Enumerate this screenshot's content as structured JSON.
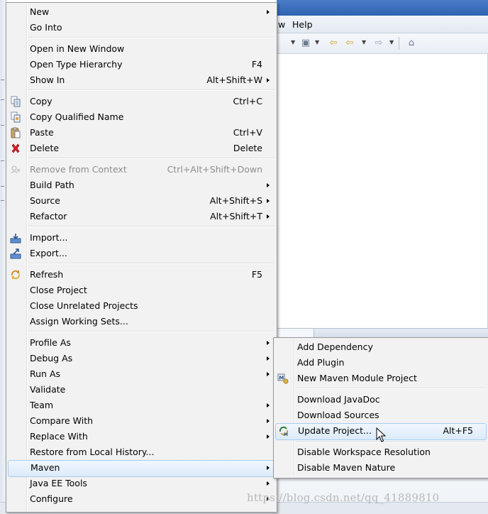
{
  "background": {
    "menubar": {
      "window_label": "w",
      "help_label": "Help"
    }
  },
  "context_menu": {
    "items": [
      {
        "label": "New",
        "submenu": true
      },
      {
        "label": "Go Into"
      },
      {
        "label": "Open in New Window"
      },
      {
        "label": "Open Type Hierarchy",
        "shortcut": "F4"
      },
      {
        "label": "Show In",
        "shortcut": "Alt+Shift+W",
        "submenu": true
      },
      {
        "label": "Copy",
        "shortcut": "Ctrl+C",
        "icon": "copy-icon"
      },
      {
        "label": "Copy Qualified Name",
        "icon": "copy-qualified-name-icon"
      },
      {
        "label": "Paste",
        "shortcut": "Ctrl+V",
        "icon": "paste-icon"
      },
      {
        "label": "Delete",
        "shortcut": "Delete",
        "icon": "delete-icon"
      },
      {
        "label": "Remove from Context",
        "shortcut": "Ctrl+Alt+Shift+Down",
        "disabled": true,
        "icon": "remove-from-context-icon"
      },
      {
        "label": "Build Path",
        "submenu": true
      },
      {
        "label": "Source",
        "shortcut": "Alt+Shift+S",
        "submenu": true
      },
      {
        "label": "Refactor",
        "shortcut": "Alt+Shift+T",
        "submenu": true
      },
      {
        "label": "Import...",
        "icon": "import-icon"
      },
      {
        "label": "Export...",
        "icon": "export-icon"
      },
      {
        "label": "Refresh",
        "shortcut": "F5",
        "icon": "refresh-icon"
      },
      {
        "label": "Close Project"
      },
      {
        "label": "Close Unrelated Projects"
      },
      {
        "label": "Assign Working Sets..."
      },
      {
        "label": "Profile As",
        "submenu": true
      },
      {
        "label": "Debug As",
        "submenu": true
      },
      {
        "label": "Run As",
        "submenu": true
      },
      {
        "label": "Validate"
      },
      {
        "label": "Team",
        "submenu": true
      },
      {
        "label": "Compare With",
        "submenu": true
      },
      {
        "label": "Replace With",
        "submenu": true
      },
      {
        "label": "Restore from Local History..."
      },
      {
        "label": "Maven",
        "submenu": true,
        "highlighted": true
      },
      {
        "label": "Java EE Tools",
        "submenu": true
      },
      {
        "label": "Configure",
        "submenu": true
      }
    ]
  },
  "maven_submenu": {
    "items": [
      {
        "label": "Add Dependency"
      },
      {
        "label": "Add Plugin"
      },
      {
        "label": "New Maven Module Project",
        "icon": "maven-module-icon"
      },
      {
        "label": "Download JavaDoc"
      },
      {
        "label": "Download Sources"
      },
      {
        "label": "Update Project...",
        "shortcut": "Alt+F5",
        "icon": "update-project-icon",
        "highlighted": true
      },
      {
        "label": "Disable Workspace Resolution"
      },
      {
        "label": "Disable Maven Nature"
      }
    ]
  },
  "watermark": "https://blog.csdn.net/qq_41889810",
  "colors": {
    "menu_background": "#f2f2f2",
    "menu_border": "#979797",
    "highlight_border": "#a8ccee",
    "highlight_fill": "#dbeafa",
    "disabled_text": "#8d8d8d",
    "delete_icon_red": "#d0202a"
  }
}
